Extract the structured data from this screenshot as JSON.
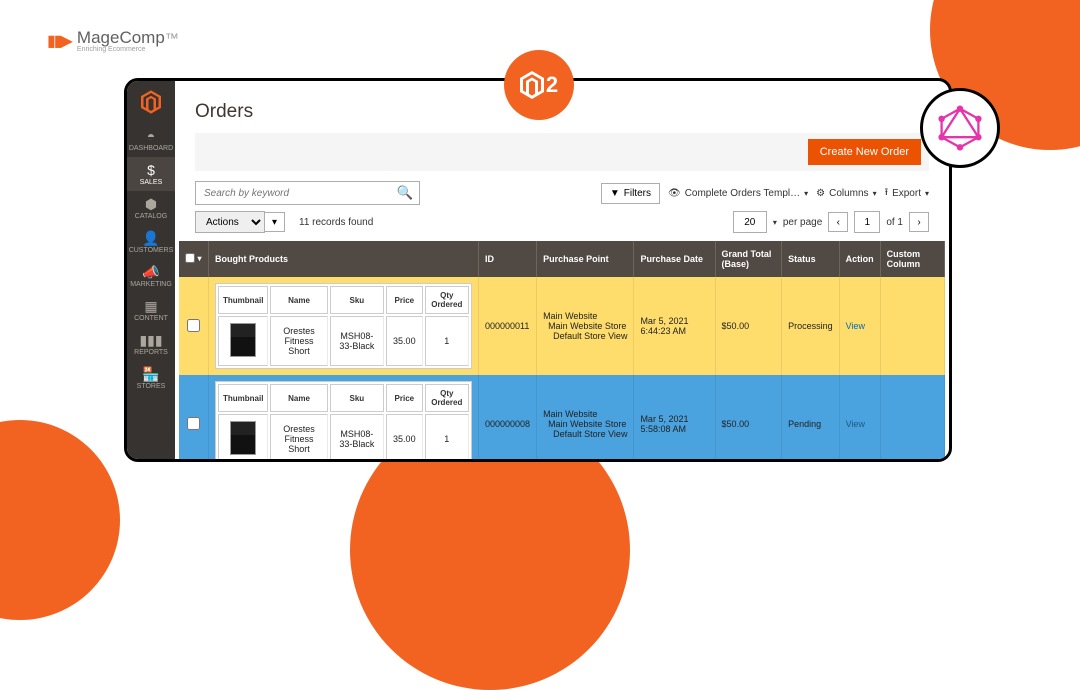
{
  "brand_logo": {
    "name": "MageComp",
    "tag": "Enriching Ecommerce"
  },
  "sidebar": {
    "items": [
      {
        "label": "DASHBOARD"
      },
      {
        "label": "SALES"
      },
      {
        "label": "CATALOG"
      },
      {
        "label": "CUSTOMERS"
      },
      {
        "label": "MARKETING"
      },
      {
        "label": "CONTENT"
      },
      {
        "label": "REPORTS"
      },
      {
        "label": "STORES"
      }
    ]
  },
  "page": {
    "title": "Orders",
    "create_button": "Create New Order"
  },
  "toolbar": {
    "search_placeholder": "Search by keyword",
    "filters": "Filters",
    "default_view": "Complete Orders Templ…",
    "columns": "Columns",
    "export": "Export"
  },
  "subbar": {
    "actions": "Actions",
    "found": "11 records found",
    "page_size": "20",
    "per_page": "per page",
    "page": "1",
    "of": "of 1"
  },
  "grid": {
    "columns": [
      "",
      "Bought Products",
      "ID",
      "Purchase Point",
      "Purchase Date",
      "Grand Total (Base)",
      "Status",
      "Action",
      "Custom Column"
    ],
    "inner_cols": [
      "Thumbnail",
      "Name",
      "Sku",
      "Price",
      "Qty Ordered"
    ],
    "rows": [
      {
        "id": "000000011",
        "purchase_point": "Main Website\n  Main Website Store\n    Default Store View",
        "purchase_date": "Mar 5, 2021 6:44:23 AM",
        "grand_total": "$50.00",
        "status": "Processing",
        "action": "View",
        "item": {
          "name": "Orestes Fitness Short",
          "sku": "MSH08-33-Black",
          "price": "35.00",
          "qty": "1"
        }
      },
      {
        "id": "000000008",
        "purchase_point": "Main Website\n  Main Website Store\n    Default Store View",
        "purchase_date": "Mar 5, 2021 5:58:08 AM",
        "grand_total": "$50.00",
        "status": "Pending",
        "action": "View",
        "item": {
          "name": "Orestes Fitness Short",
          "sku": "MSH08-33-Black",
          "price": "35.00",
          "qty": "1"
        }
      }
    ]
  }
}
